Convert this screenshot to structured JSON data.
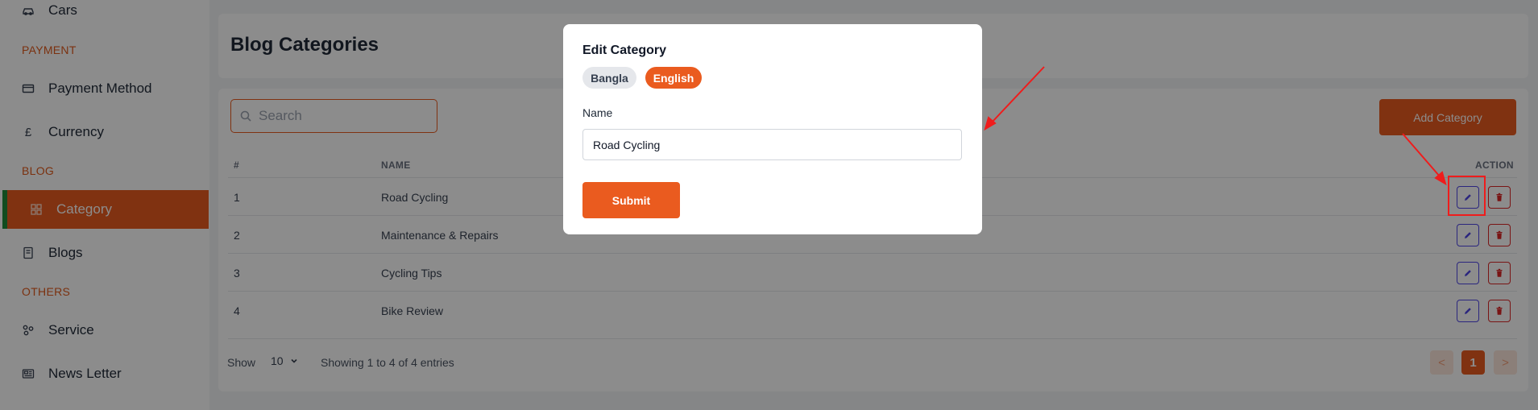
{
  "sidebar": {
    "items": [
      {
        "label": "Cars",
        "icon": "car-icon"
      },
      {
        "label": "Payment Method",
        "icon": "credit-card-icon"
      },
      {
        "label": "Currency",
        "icon": "pound-icon"
      },
      {
        "label": "Category",
        "icon": "grid-icon",
        "active": true
      },
      {
        "label": "Blogs",
        "icon": "document-icon"
      },
      {
        "label": "Service",
        "icon": "service-icon"
      },
      {
        "label": "News Letter",
        "icon": "newspaper-icon"
      }
    ],
    "sections": {
      "payment": "PAYMENT",
      "blog": "BLOG",
      "others": "OTHERS"
    }
  },
  "page": {
    "title": "Blog Categories",
    "search_placeholder": "Search",
    "add_button": "Add Category"
  },
  "table": {
    "headers": {
      "num": "#",
      "name": "NAME",
      "action": "ACTION"
    },
    "rows": [
      {
        "num": "1",
        "name": "Road Cycling"
      },
      {
        "num": "2",
        "name": "Maintenance & Repairs"
      },
      {
        "num": "3",
        "name": "Cycling Tips"
      },
      {
        "num": "4",
        "name": "Bike Review"
      }
    ]
  },
  "footer": {
    "show_label": "Show",
    "page_size": "10",
    "entries_text": "Showing 1 to 4 of 4 entries",
    "prev": "<",
    "current_page": "1",
    "next": ">"
  },
  "modal": {
    "title": "Edit Category",
    "tabs": [
      "Bangla",
      "English"
    ],
    "active_tab": "English",
    "name_label": "Name",
    "name_value": "Road Cycling",
    "submit_label": "Submit"
  },
  "colors": {
    "accent": "#ea5b1f",
    "annotation": "#ef1c1c"
  }
}
